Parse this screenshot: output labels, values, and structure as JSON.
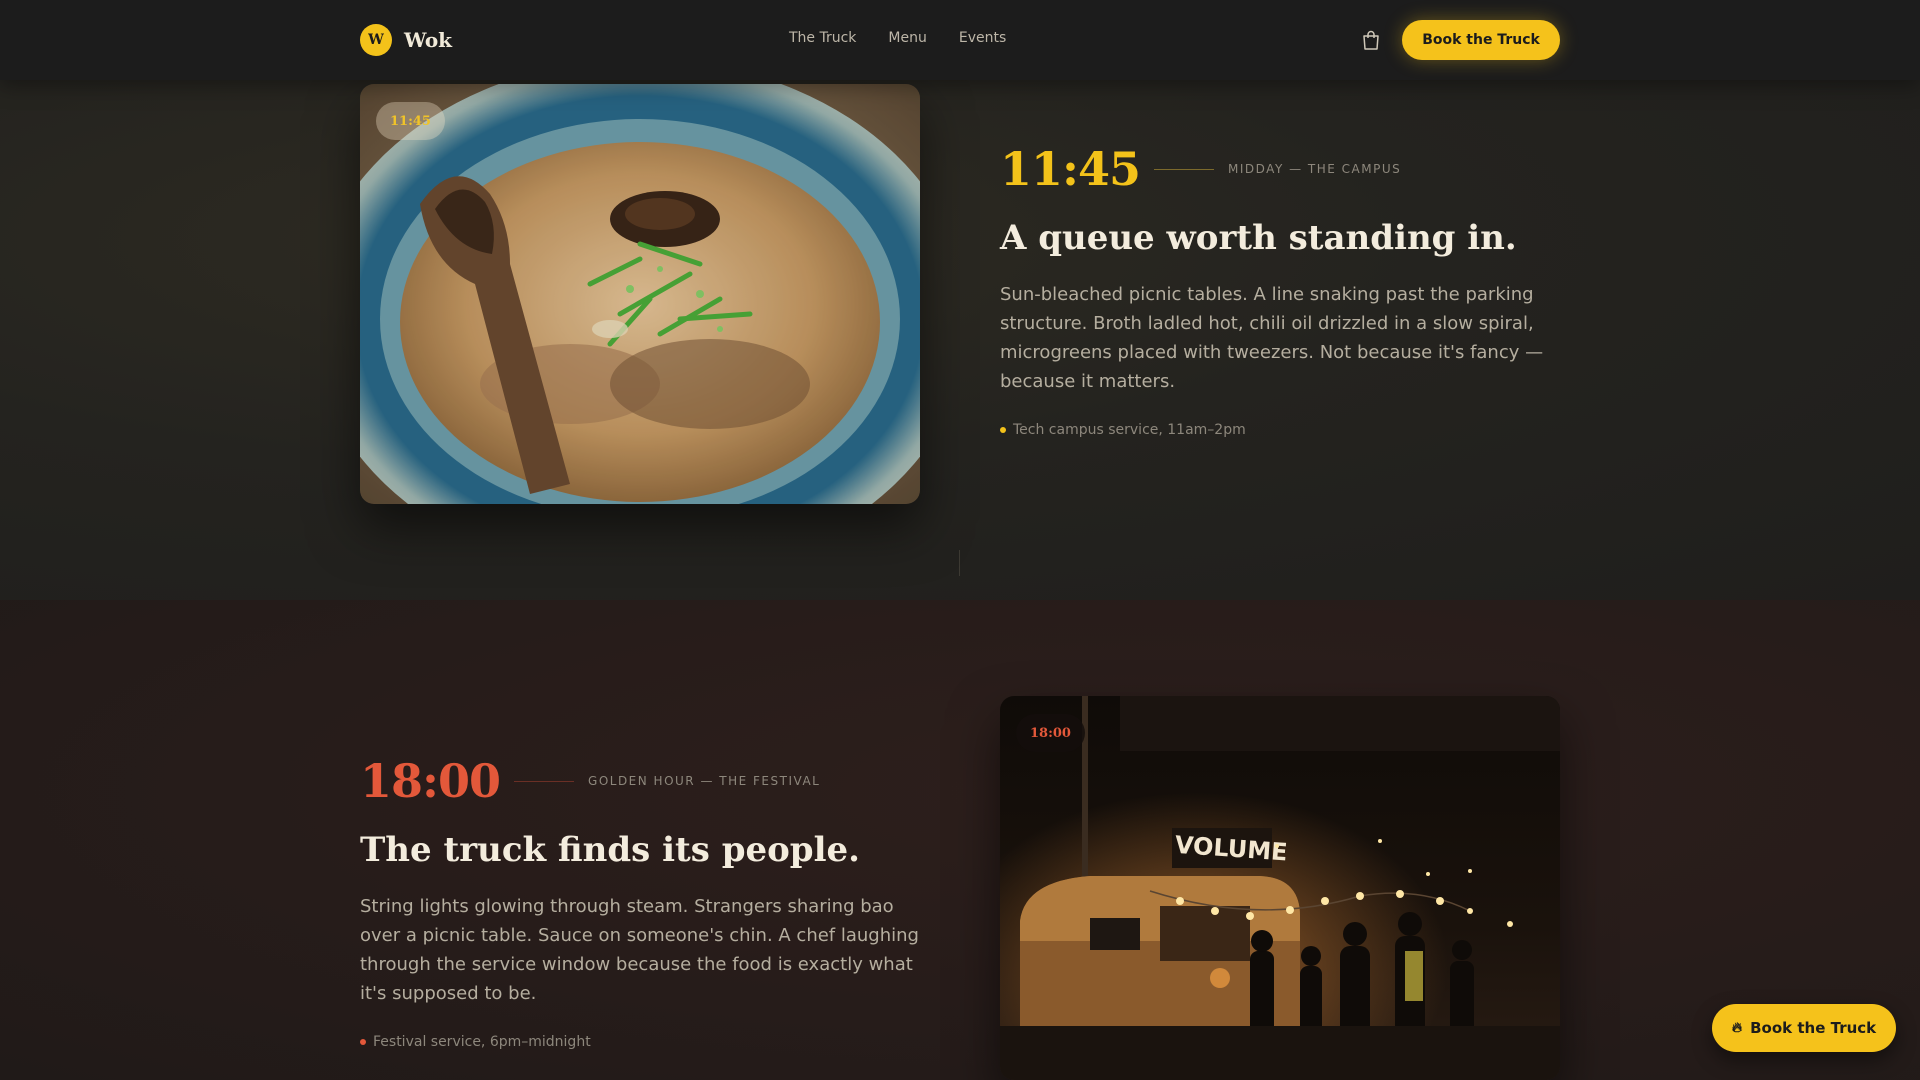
{
  "nav": {
    "brand_mark": "W",
    "brand_name": "Wok",
    "links": [
      "The Truck",
      "Menu",
      "Events"
    ],
    "cart_icon": "shopping-bag-icon",
    "cta_label": "Book the Truck"
  },
  "midday": {
    "chip": "11:45",
    "time": "11:45",
    "caption": "MIDDAY — THE CAMPUS",
    "headline": "A queue worth standing in.",
    "body": "Sun-bleached picnic tables. A line snaking past the parking structure. Broth ladled hot, chili oil drizzled in a slow spiral, microgreens placed with tweezers. Not because it's fancy — because it matters.",
    "meta": "Tech campus service, 11am–2pm",
    "accent": "#f3c21a"
  },
  "golden": {
    "chip": "18:00",
    "time": "18:00",
    "caption": "GOLDEN HOUR — THE FESTIVAL",
    "headline": "The truck finds its people.",
    "body": "String lights glowing through steam. Strangers sharing bao over a picnic table. Sauce on someone's chin. A chef laughing through the service window because the food is exactly what it's supposed to be.",
    "meta": "Festival service, 6pm–midnight",
    "accent": "#e3583a",
    "truck_sign": "VOLUME"
  },
  "floating_cta": {
    "icon": "flame-icon",
    "label": "Book the Truck"
  }
}
